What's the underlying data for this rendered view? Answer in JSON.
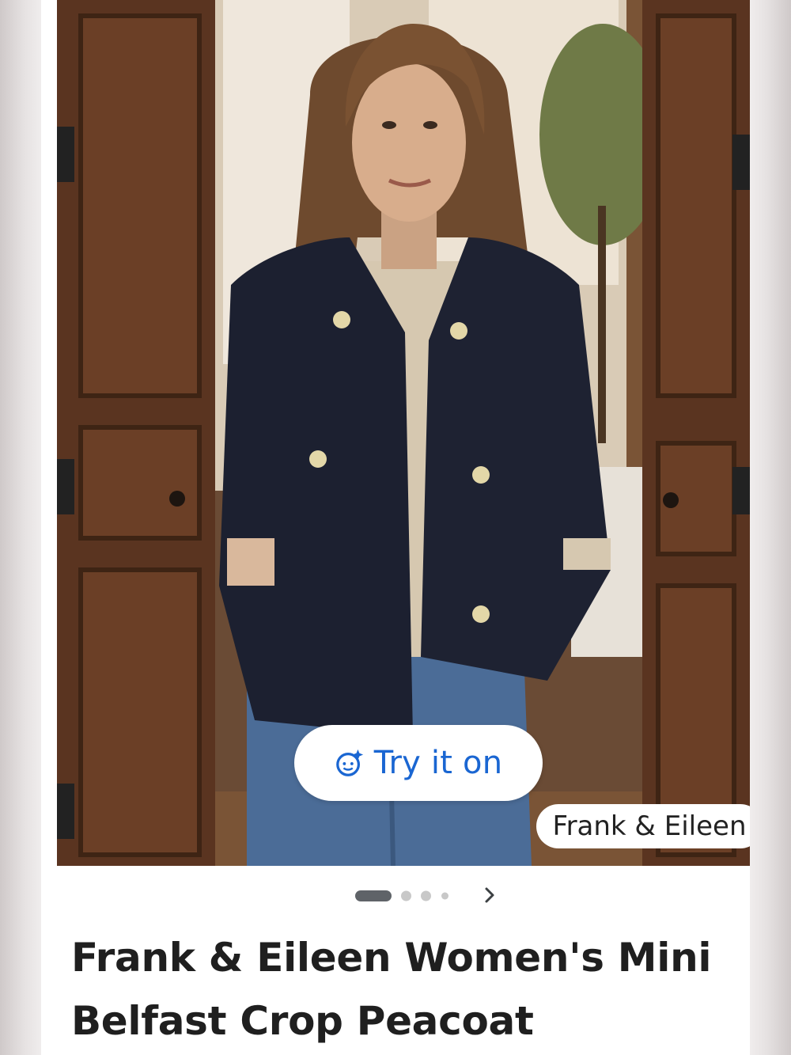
{
  "product": {
    "try_on_label": "Try it on",
    "try_on_icon": "face-sparkle-icon",
    "brand_chip": "Frank & Eileen",
    "title": "Frank & Eileen Women's Mini Belfast Crop Peacoat"
  },
  "carousel": {
    "image_count": 4,
    "active_index": 0,
    "next_icon": "chevron-right-icon"
  },
  "colors": {
    "accent_blue": "#1a66d2",
    "title_text": "#1f1f1f",
    "dot_active": "#5f6368",
    "dot_inactive": "#c8c8c8"
  }
}
